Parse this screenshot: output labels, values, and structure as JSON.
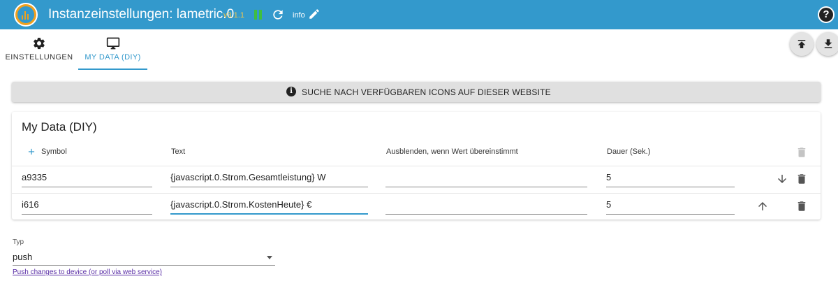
{
  "header": {
    "title": "Instanzeinstellungen: lametric.0",
    "version": "v3.1.1",
    "info_label": "info",
    "help_label": "?"
  },
  "tabs": [
    {
      "label": "EINSTELLUNGEN",
      "icon": "gear-icon"
    },
    {
      "label": "MY DATA (DIY)",
      "icon": "monitor-icon",
      "active": true
    }
  ],
  "banner": {
    "text": "SUCHE NACH VERFÜGBAREN ICONS AUF DIESER WEBSITE",
    "icon_glyph": "i"
  },
  "table": {
    "title": "My Data (DIY)",
    "columns": {
      "symbol": "Symbol",
      "text": "Text",
      "hide": "Ausblenden, wenn Wert übereinstimmt",
      "duration": "Dauer (Sek.)"
    },
    "rows": [
      {
        "symbol": "a9335",
        "text": "{javascript.0.Strom.Gesamtleistung} W",
        "hide": "",
        "duration": "5"
      },
      {
        "symbol": "i616",
        "text": "{javascript.0.Strom.KostenHeute} €",
        "hide": "",
        "duration": "5"
      }
    ]
  },
  "typ": {
    "label": "Typ",
    "value": "push",
    "link": "Push changes to device (or poll via web service)"
  },
  "colors": {
    "header_bg": "#3399cc",
    "accent": "#3399cc",
    "version": "#f3c64a",
    "pause": "#3fbf3f",
    "link": "#5a2ea6"
  }
}
